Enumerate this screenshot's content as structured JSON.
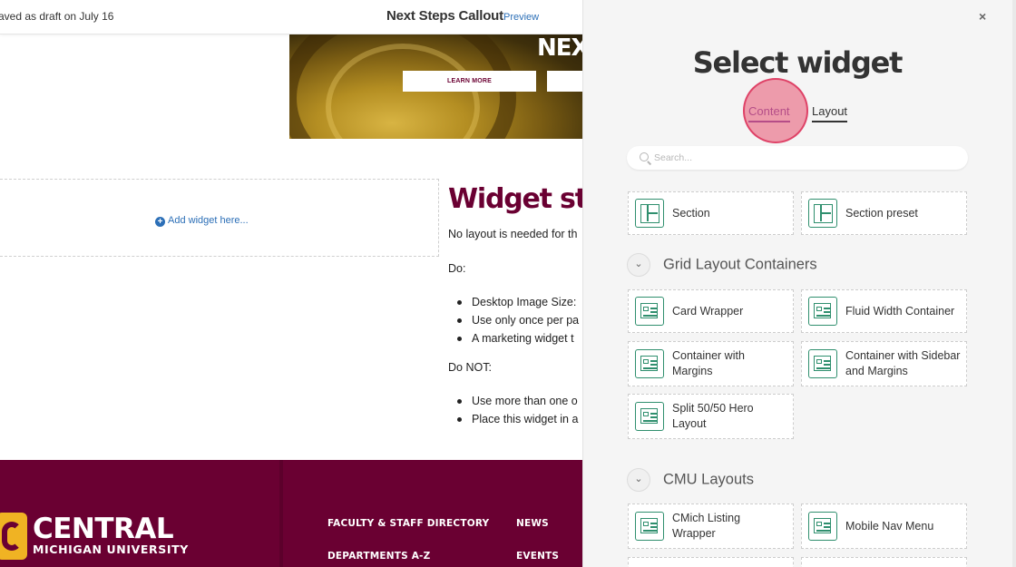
{
  "editor": {
    "saved_status": "aved as draft on July 16",
    "doc_title": "Next Steps Callout",
    "preview_label": "Preview"
  },
  "hero": {
    "heading": "NEXT",
    "button_primary": "LEARN MORE",
    "button_secondary": ""
  },
  "drop_zone": {
    "add_widget_label": "Add widget here..."
  },
  "content": {
    "heading": "Widget sta",
    "intro": "No layout is needed for th",
    "do_label": "Do:",
    "do_items": [
      "Desktop Image Size: ",
      "Use only once per pa",
      "A marketing widget t"
    ],
    "donot_label": "Do NOT:",
    "donot_items": [
      "Use more than one o",
      "Place this widget in a"
    ]
  },
  "footer": {
    "logo_name": "CENTRAL",
    "logo_sub": "MICHIGAN UNIVERSITY",
    "links": [
      "FACULTY & STAFF DIRECTORY",
      "NEWS",
      "DEPARTMENTS A-Z",
      "EVENTS"
    ]
  },
  "panel": {
    "close_glyph": "×",
    "title": "Select widget",
    "tabs": [
      {
        "label": "Content",
        "active": true
      },
      {
        "label": "Layout",
        "active": false
      }
    ],
    "search_placeholder": "Search...",
    "top_cards": [
      {
        "label": "Section",
        "icon": "section-icon"
      },
      {
        "label": "Section preset",
        "icon": "section-icon"
      }
    ],
    "groups": [
      {
        "title": "Grid Layout Containers",
        "cards": [
          {
            "label": "Card Wrapper",
            "icon": "layout-icon"
          },
          {
            "label": "Fluid Width Container",
            "icon": "layout-icon"
          },
          {
            "label": "Container with Margins",
            "icon": "layout-icon"
          },
          {
            "label": "Container with Sidebar and Margins",
            "icon": "layout-icon"
          },
          {
            "label": "Split 50/50 Hero Layout",
            "icon": "layout-icon"
          }
        ]
      },
      {
        "title": "CMU Layouts",
        "cards": [
          {
            "label": "CMich Listing Wrapper",
            "icon": "layout-icon"
          },
          {
            "label": "Mobile Nav Menu",
            "icon": "layout-icon"
          }
        ]
      }
    ]
  },
  "colors": {
    "brand_maroon": "#6a0032",
    "brand_gold": "#f0b323",
    "link_blue": "#2c6fb7",
    "widget_icon_green": "#2f8f6e",
    "active_tab_purple": "#7a4aa8",
    "click_marker": "#e6506e"
  }
}
